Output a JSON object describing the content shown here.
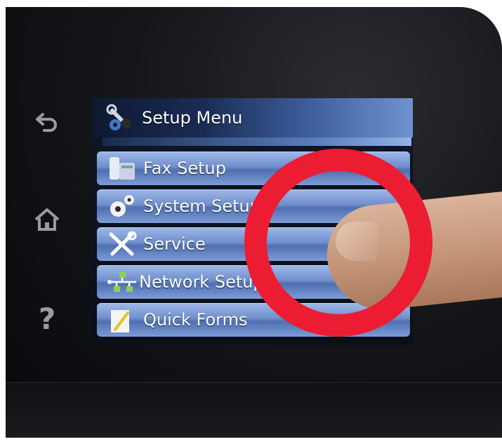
{
  "side_buttons": {
    "back": "back-arrow-icon",
    "home": "home-icon",
    "help": "?"
  },
  "screen": {
    "title": "Setup Menu",
    "title_icon": "wrench-gear-icon",
    "items": [
      {
        "label": "Fax Setup",
        "icon": "fax-icon"
      },
      {
        "label": "System Setup",
        "icon": "gears-icon"
      },
      {
        "label": "Service",
        "icon": "tools-icon"
      },
      {
        "label": "Network Setup",
        "icon": "network-icon"
      },
      {
        "label": "Quick Forms",
        "icon": "pencil-form-icon"
      }
    ]
  },
  "colors": {
    "highlight_ring": "#ec1c33",
    "menu_item": "#6f8fcc"
  }
}
